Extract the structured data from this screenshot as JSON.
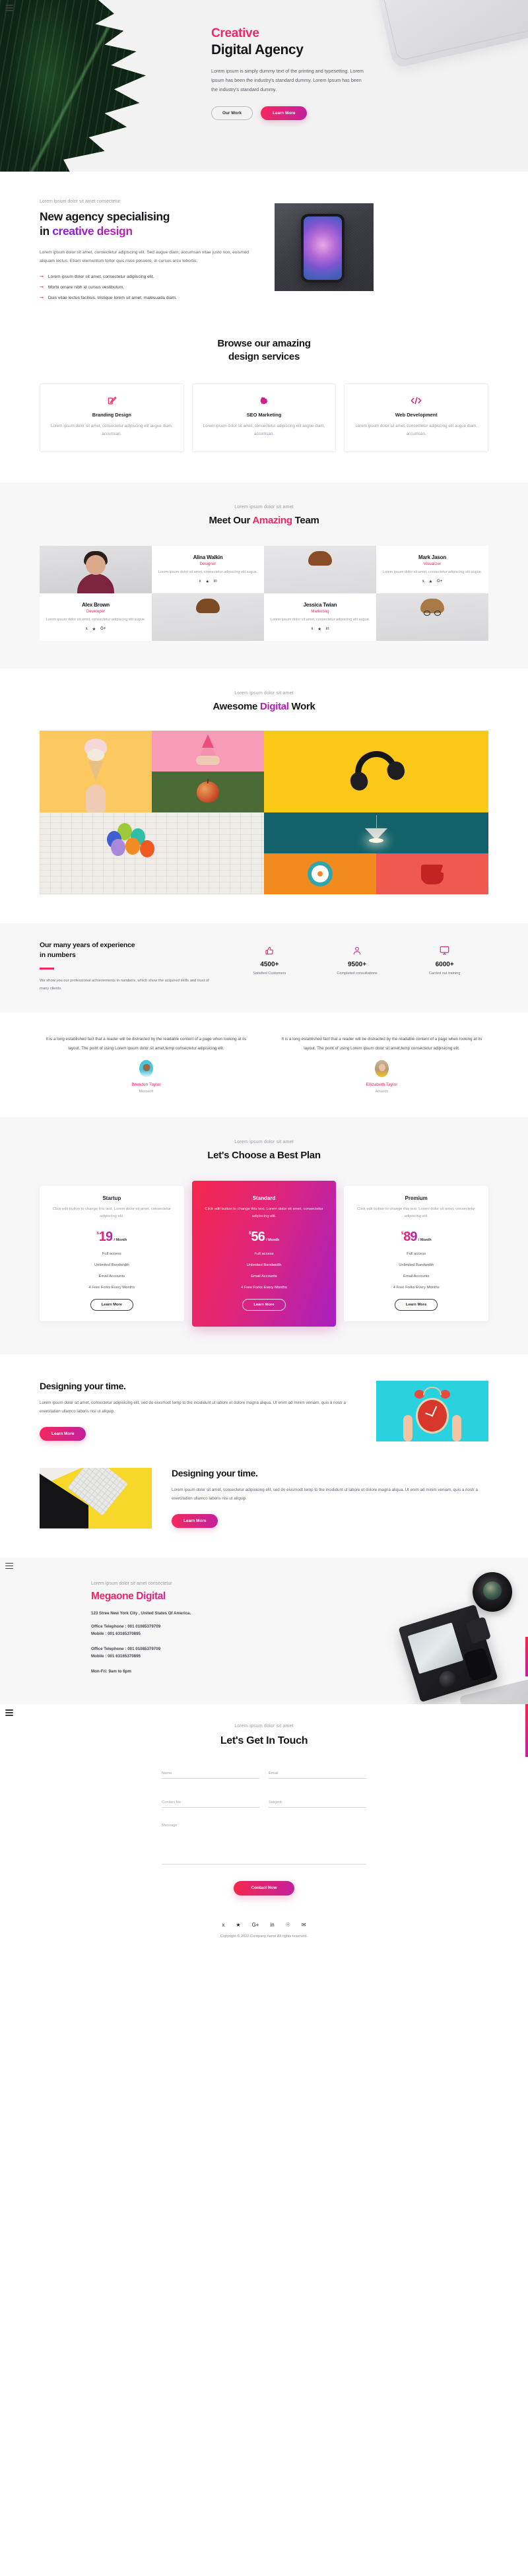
{
  "hero": {
    "eyebrow_accent": "Creative",
    "title": "Digital Agency",
    "paragraph": "Lorem ipsum is simply dummy text of the printing and typesetting. Lorem Ipsum has been the industry's standard dummy. Lorem Ipsum has been the industry's standard dummy.",
    "btn_secondary": "Our Work",
    "btn_primary": "Learn More"
  },
  "about": {
    "eyebrow": "Lorem ipsum dolor sit amet consectetur",
    "title_line1": "New agency specialising",
    "title_line2_plain": "in ",
    "title_line2_accent": "creative design",
    "paragraph": "Lorem ipsum dolor sit amet, consectetur adipiscing elit. Sed augue diam, accumsan vitae justo non, euismod aliquam lectus. Etiam elementum tortor quis risus posuere, in cursus arcu lobortis.",
    "bullets": [
      "Lorem ipsum dolor sit amet, consectetur adipiscing elit.",
      "Morbi ornare nibh id cursus vestibulum.",
      "Duis vitae lectus facilisis, tristique lorem sit amet, malesuada diam."
    ]
  },
  "services": {
    "title_line1": "Browse our amazing",
    "title_line2": "design services",
    "cards": [
      {
        "icon": "pencil-square-icon",
        "title": "Branding Design",
        "desc": "Lorem ipsum dolor sit amet, consectetur adipiscing elit augue diam, accumsan."
      },
      {
        "icon": "gear-icon",
        "title": "SEO Marketing",
        "desc": "Lorem ipsum dolor sit amet, consectetur adipiscing elit augue diam, accumsan."
      },
      {
        "icon": "code-icon",
        "title": "Web Development",
        "desc": "Lorem ipsum dolor sit amet, consectetur adipiscing elit augue diam, accumsan."
      }
    ]
  },
  "team": {
    "eyebrow": "Lorem ipsum dolor sit amet",
    "title_a": "Meet Our ",
    "title_accent": "Amazing",
    "title_b": " Team",
    "members": [
      {
        "name": "Alina Walkin",
        "role": "Designer",
        "bio": "Lorem ipsum dolor sit amet, consectetur adipiscing elit augue.",
        "socials": [
          "facebook-icon",
          "twitter-icon",
          "linkedin-icon"
        ]
      },
      {
        "name": "Mark Jason",
        "role": "Visualizer",
        "bio": "Lorem ipsum dolor sit amet, consectetur adipiscing elit augue.",
        "socials": [
          "facebook-icon",
          "twitter-icon",
          "googleplus-icon"
        ]
      },
      {
        "name": "Alex Brown",
        "role": "Developer",
        "bio": "Lorem ipsum dolor sit amet, consectetur adipiscing elit augue.",
        "socials": [
          "facebook-icon",
          "twitter-icon",
          "googleplus-icon"
        ]
      },
      {
        "name": "Jessica Twian",
        "role": "Marketing",
        "bio": "Lorem ipsum dolor sit amet, consectetur adipiscing elit augue.",
        "socials": [
          "facebook-icon",
          "twitter-icon",
          "linkedin-icon"
        ]
      }
    ]
  },
  "work": {
    "eyebrow": "Lorem ipsum dolor sit amet",
    "title_a": "Awesome ",
    "title_accent": "Digital",
    "title_b": " Work",
    "tiles": [
      "ice-cream-cone",
      "pink-pineapple",
      "red-apple",
      "black-headphones",
      "party-balloons",
      "pendant-lamp",
      "orange-slice-plate",
      "red-drink-cup"
    ]
  },
  "numbers": {
    "title_line1": "Our many years of experience",
    "title_line2": "in numbers",
    "paragraph": "We show you our professional achievements in numbers, which show the acquired skills and trust of many clients.",
    "stats": [
      {
        "icon": "thumbs-up-icon",
        "value": "4500+",
        "label": "Satisfied Customers"
      },
      {
        "icon": "user-icon",
        "value": "9500+",
        "label": "Completed consultations"
      },
      {
        "icon": "monitor-icon",
        "value": "6000+",
        "label": "Carried out training"
      }
    ]
  },
  "testimonials": [
    {
      "quote": "It is a long established fact that a reader will be distracted by the readable content of a page when looking at its layout. The point of using Lorem ipsum dolor sit amet,temp consectetur adipisicing elit.",
      "name": "Brenden Taylor",
      "company": "Microsoft"
    },
    {
      "quote": "It is a long established fact that a reader will be distracted by the readable content of a page when looking at its layout. The point of using Lorem ipsum dolor sit amet,temp consectetur adipisicing elit.",
      "name": "Ellizabeth Taylor",
      "company": "Amazon"
    }
  ],
  "pricing": {
    "eyebrow": "Lorem ipsum dolor sit amet",
    "title": "Let's Choose a Best Plan",
    "plans": [
      {
        "name": "Startup",
        "desc": "Click edit button to change this text. Lorem dolor sit amet, consectetur adipiscing elit.",
        "currency": "$",
        "amount": "19",
        "period": "/ Month",
        "features": [
          "Full access",
          "Unlimited Bandwidth",
          "Email Accounts",
          "4 Free Forks Every Months"
        ],
        "cta": "Learn More",
        "featured": false
      },
      {
        "name": "Standard",
        "desc": "Click edit button to change this text. Lorem dolor sit amet, consectetur adipiscing elit.",
        "currency": "$",
        "amount": "56",
        "period": "/ Month",
        "features": [
          "Full access",
          "Unlimited Bandwidth",
          "Email Accounts",
          "4 Free Forks Every Months"
        ],
        "cta": "Learn More",
        "featured": true
      },
      {
        "name": "Premium",
        "desc": "Click edit button to change this text. Lorem dolor sit amet, consectetur adipiscing elit.",
        "currency": "$",
        "amount": "89",
        "period": "/ Month",
        "features": [
          "Full access",
          "Unlimited Bandwidth",
          "Email Accounts",
          "4 Free Forks Every Months"
        ],
        "cta": "Learn More",
        "featured": false
      }
    ]
  },
  "features": [
    {
      "title": "Designing your time.",
      "paragraph": "Lorem ipsum dolor sit amet, consectetur adipisicing elit, sed do eiusmodt temp to the incididunt ut labore et dolore magna aliqua. Ut enim ad minim veniam, quis a nostr a exercitation ullamco laboris nisi ut aliquip.",
      "cta": "Learn More",
      "image": "red-alarm-clock-held-in-hands"
    },
    {
      "title": "Designing your time.",
      "paragraph": "Lorem ipsum dolor sit amet, consectetur adipisicing elit, sed do eiusmodt temp to the incididunt ut labore et dolore magna aliqua. Ut enim ad minim veniam, quis a nostr a exercitation ullamco laboris nisi ut aliquip.",
      "cta": "Learn More",
      "image": "keyboard-tablet-on-yellow-desk"
    }
  ],
  "contact_info": {
    "eyebrow": "Lorem ipsum dolor sit amet consectetur",
    "brand": "Megaone Digital",
    "address": "123 Stree New York City , United States Of America.",
    "block1_line1": "Office Telephone : 001 01085379709",
    "block1_line2": "Mobile : 001 63165370895",
    "block2_line1": "Office Telephone : 001 01085379709",
    "block2_line2": "Mobile : 001 63165370895",
    "hours": "Mon-Fri: 9am to 6pm",
    "image": "sony-camera-lens-on-desk"
  },
  "contact_form": {
    "eyebrow": "Lorem ipsum dolor sit amet",
    "title": "Let's Get In Touch",
    "fields": {
      "name": {
        "placeholder": "Name",
        "value": ""
      },
      "email": {
        "placeholder": "Email",
        "value": ""
      },
      "contact_no": {
        "placeholder": "Contact No",
        "value": ""
      },
      "subject": {
        "placeholder": "Subject",
        "value": ""
      },
      "message": {
        "placeholder": "Message",
        "value": ""
      }
    },
    "submit": "Contact Now",
    "socials": [
      "facebook-icon",
      "twitter-icon",
      "googleplus-icon",
      "linkedin-icon",
      "pinterest-icon",
      "envelope-icon"
    ],
    "copyright": "Copyright © 2022.Company name All rights reserved."
  },
  "colors": {
    "accent_pink": "#f5275f",
    "accent_purple": "#b21fb8",
    "gradient_start": "#f5274d",
    "gradient_end": "#c3219c",
    "section_gray": "#f7f7f8",
    "text_dark": "#16161a",
    "text_muted": "#9b9ba2"
  }
}
